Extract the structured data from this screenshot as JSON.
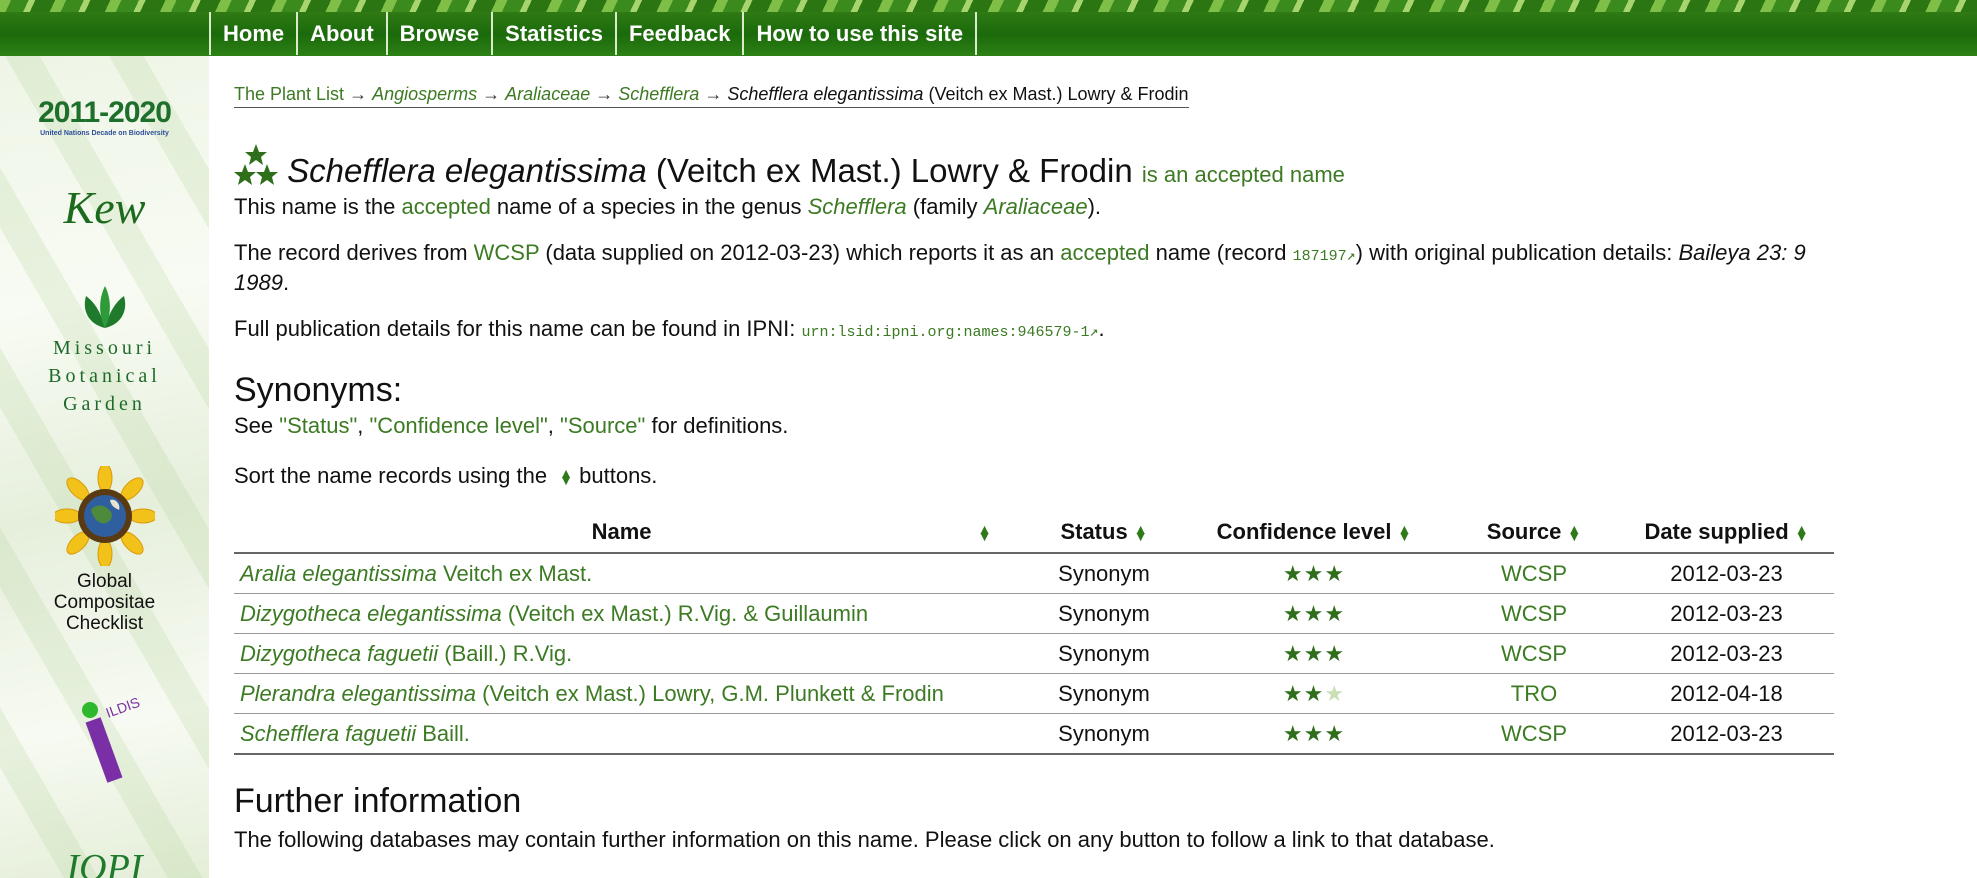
{
  "nav": {
    "items": [
      "Home",
      "About",
      "Browse",
      "Statistics",
      "Feedback",
      "How to use this site"
    ]
  },
  "sidebar": {
    "logo_2011": "2011-2020",
    "logo_2011_sub": "United Nations Decade on Biodiversity",
    "logo_kew": "Kew",
    "logo_mbg_lines": [
      "Missouri",
      "Botanical",
      "Garden"
    ],
    "logo_gcc_lines": [
      "Global",
      "Compositae",
      "Checklist"
    ],
    "logo_ildis": "ILDIS",
    "logo_iopi": "IOPI"
  },
  "breadcrumb": {
    "root": "The Plant List",
    "sep": "→",
    "group": "Angiosperms",
    "family": "Araliaceae",
    "genus": "Schefflera",
    "current_name": "Schefflera elegantissima",
    "current_author": "(Veitch ex Mast.) Lowry & Frodin"
  },
  "title": {
    "name": "Schefflera elegantissima",
    "author": "(Veitch ex Mast.) Lowry & Frodin",
    "status": "is an accepted name"
  },
  "para1": {
    "t1": "This name is the ",
    "link_accepted": "accepted",
    "t2": " name of a species in the genus ",
    "link_genus": "Schefflera",
    "t3": " (family ",
    "link_family": "Araliaceae",
    "t4": ")."
  },
  "para2": {
    "t1": "The record derives from ",
    "link_source": "WCSP",
    "t2": " (data supplied on 2012-03-23) which reports it as an ",
    "link_accepted": "accepted",
    "t3": " name (record ",
    "record_id": "187197↗",
    "t4": ") with original publication details: ",
    "pub_line1": "Baileya 23: 9",
    "pub_line2": "1989",
    "t5": "."
  },
  "para3": {
    "t1": "Full publication details for this name can be found in IPNI: ",
    "lsid": "urn:lsid:ipni.org:names:946579-1↗",
    "t2": "."
  },
  "synonyms": {
    "heading": "Synonyms:",
    "see_t1": "See ",
    "link_status": "\"Status\"",
    "comma1": ", ",
    "link_conf": "\"Confidence level\"",
    "comma2": ", ",
    "link_source": "\"Source\"",
    "see_t2": " for definitions.",
    "sort_t1": "Sort the name records using the ",
    "sort_t2": " buttons.",
    "columns": [
      "Name",
      "Status",
      "Confidence level",
      "Source",
      "Date supplied"
    ],
    "rows": [
      {
        "genus_species": "Aralia elegantissima",
        "author": "Veitch ex Mast.",
        "status": "Synonym",
        "confidence": 3,
        "source": "WCSP",
        "date": "2012-03-23"
      },
      {
        "genus_species": "Dizygotheca elegantissima",
        "author": "(Veitch ex Mast.) R.Vig. & Guillaumin",
        "status": "Synonym",
        "confidence": 3,
        "source": "WCSP",
        "date": "2012-03-23"
      },
      {
        "genus_species": "Dizygotheca faguetii",
        "author": "(Baill.) R.Vig.",
        "status": "Synonym",
        "confidence": 3,
        "source": "WCSP",
        "date": "2012-03-23"
      },
      {
        "genus_species": "Plerandra elegantissima",
        "author": "(Veitch ex Mast.) Lowry, G.M. Plunkett & Frodin",
        "status": "Synonym",
        "confidence": 2,
        "source": "TRO",
        "date": "2012-04-18"
      },
      {
        "genus_species": "Schefflera faguetii",
        "author": "Baill.",
        "status": "Synonym",
        "confidence": 3,
        "source": "WCSP",
        "date": "2012-03-23"
      }
    ]
  },
  "further": {
    "heading": "Further information",
    "text": "The following databases may contain further information on this name. Please click on any button to follow a link to that database."
  },
  "colors": {
    "link": "#3c7a23",
    "nav_bg": "#1b6a0b",
    "star": "#2f6e1a",
    "star_light": "#c9e0b4"
  }
}
